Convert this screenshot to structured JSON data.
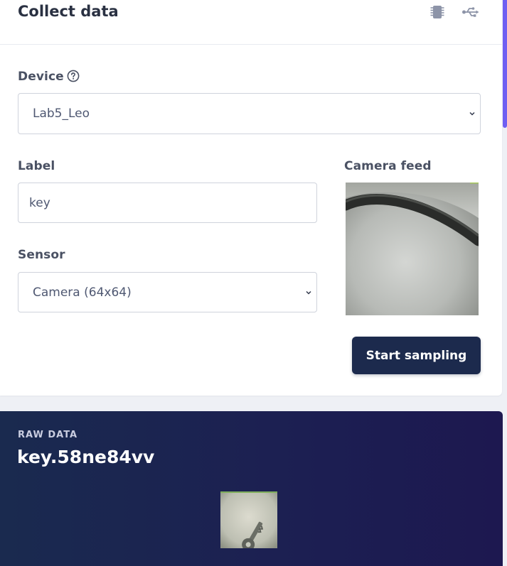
{
  "header": {
    "title": "Collect data",
    "icons": [
      "chip-icon",
      "usb-icon"
    ]
  },
  "device": {
    "label": "Device",
    "help_icon": "question-circle-icon",
    "selected": "Lab5_Leo"
  },
  "label_field": {
    "label": "Label",
    "value": "key"
  },
  "sensor": {
    "label": "Sensor",
    "selected": "Camera (64x64)"
  },
  "camera": {
    "label": "Camera feed"
  },
  "actions": {
    "start_sampling": "Start sampling"
  },
  "raw_data": {
    "kicker": "RAW DATA",
    "title": "key.58ne84vv"
  },
  "colors": {
    "primary_button": "#1c2a4d",
    "scrollbar_accent": "#6f5ff2",
    "raw_panel_bg": "#1c1f52"
  }
}
